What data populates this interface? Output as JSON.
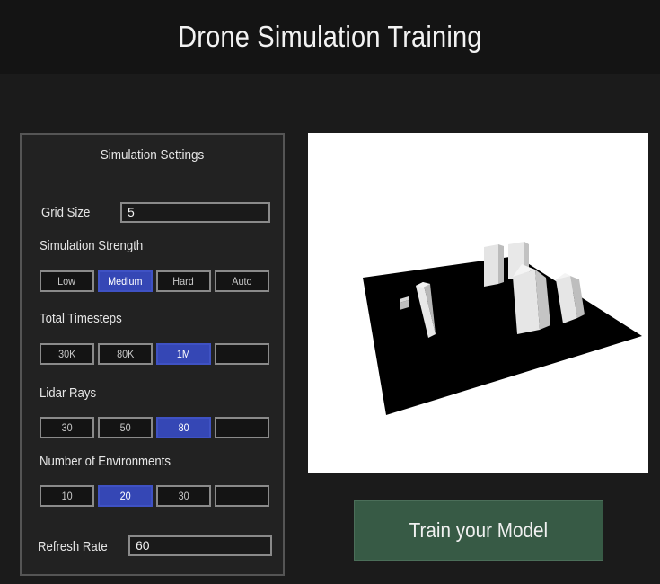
{
  "app": {
    "title": "Drone Simulation Training"
  },
  "settings": {
    "title": "Simulation Settings",
    "grid_size": {
      "label": "Grid Size",
      "value": "5"
    },
    "strength": {
      "label": "Simulation Strength",
      "options": [
        "Low",
        "Medium",
        "Hard",
        "Auto"
      ],
      "selected": "Medium"
    },
    "timesteps": {
      "label": "Total Timesteps",
      "options": [
        "30K",
        "80K",
        "1M",
        ""
      ],
      "selected": "1M"
    },
    "lidar": {
      "label": "Lidar Rays",
      "options": [
        "30",
        "50",
        "80",
        ""
      ],
      "selected": "80"
    },
    "environments": {
      "label": "Number of Environments",
      "options": [
        "10",
        "20",
        "30",
        ""
      ],
      "selected": "20"
    },
    "refresh_rate": {
      "label": "Refresh Rate",
      "value": "60"
    }
  },
  "actions": {
    "train_label": "Train your Model"
  },
  "colors": {
    "accent": "#3547b5",
    "train_button": "#375a45",
    "viewport_bg": "#ffffff",
    "ground": "#000000",
    "obstacle": "#e4e4e4"
  }
}
